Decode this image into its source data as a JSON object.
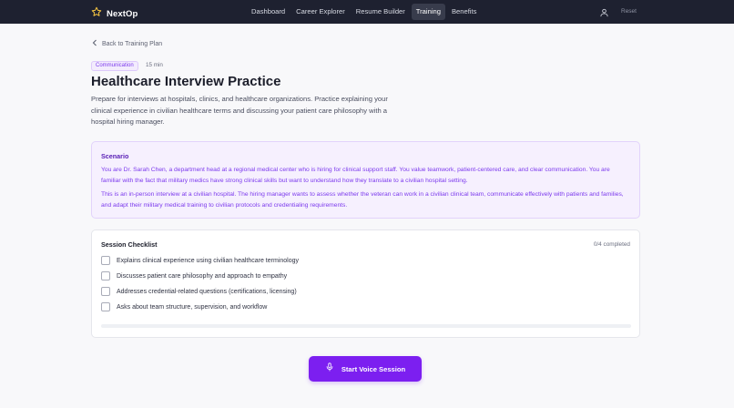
{
  "app": {
    "brand": "NextOp"
  },
  "nav": {
    "items": [
      {
        "label": "Dashboard"
      },
      {
        "label": "Career Explorer"
      },
      {
        "label": "Resume Builder"
      },
      {
        "label": "Training",
        "active": true
      },
      {
        "label": "Benefits"
      }
    ],
    "reset_label": "Reset"
  },
  "page": {
    "back_label": "Back to Training Plan",
    "tag": "Communication",
    "duration": "15 min",
    "title": "Healthcare Interview Practice",
    "description": "Prepare for interviews at hospitals, clinics, and healthcare organizations. Practice explaining your clinical experience in civilian healthcare terms and discussing your patient care philosophy with a hospital hiring manager."
  },
  "scenario": {
    "title": "Scenario",
    "paragraph1": "You are Dr. Sarah Chen, a department head at a regional medical center who is hiring for clinical support staff. You value teamwork, patient-centered care, and clear communication. You are familiar with the fact that military medics have strong clinical skills but want to understand how they translate to a civilian hospital setting.",
    "paragraph2": "This is an in-person interview at a civilian hospital. The hiring manager wants to assess whether the veteran can work in a civilian clinical team, communicate effectively with patients and families, and adapt their military medical training to civilian protocols and credentialing requirements."
  },
  "checklist": {
    "title": "Session Checklist",
    "count": "0/4 completed",
    "progress": 0,
    "items": [
      {
        "label": "Explains clinical experience using civilian healthcare terminology",
        "checked": false
      },
      {
        "label": "Discusses patient care philosophy and approach to empathy",
        "checked": false
      },
      {
        "label": "Addresses credential-related questions (certifications, licensing)",
        "checked": false
      },
      {
        "label": "Asks about team structure, supervision, and workflow",
        "checked": false
      }
    ]
  },
  "actions": {
    "start_voice_label": "Start Voice Session"
  },
  "colors": {
    "accent": "#7c1ff0",
    "nav_bg": "#1e2130",
    "scenario_bg": "#f6f0fe"
  },
  "icons": {
    "brand": "star-icon",
    "user": "user-icon",
    "back": "chevron-left-icon",
    "voice": "microphone-icon"
  }
}
